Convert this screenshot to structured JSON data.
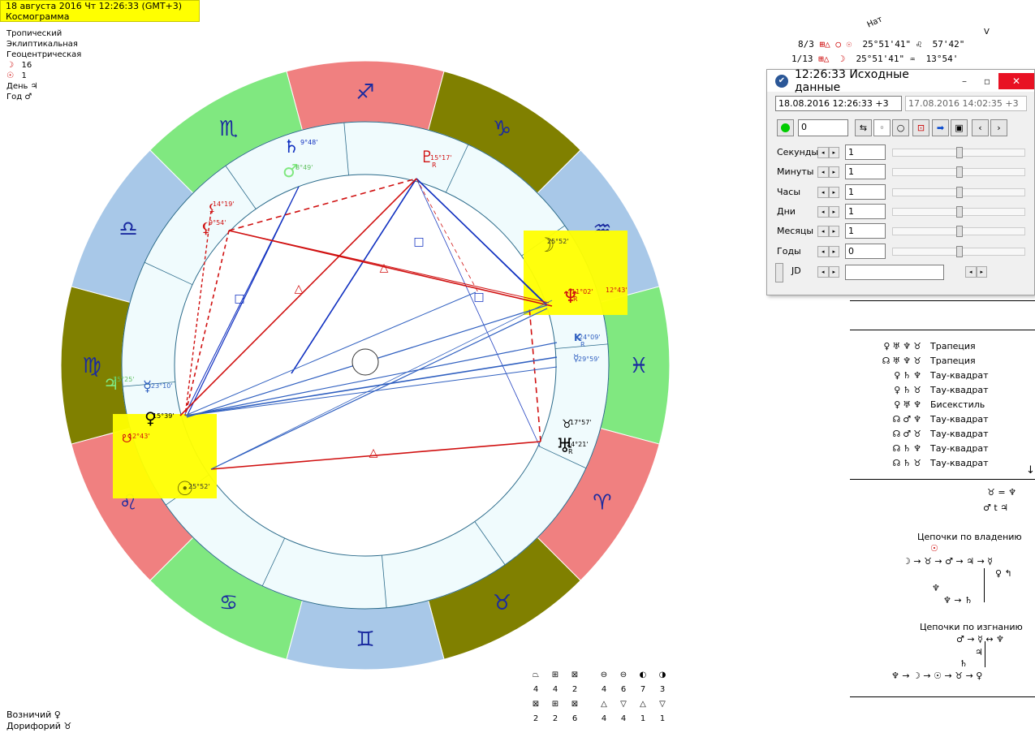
{
  "header": {
    "datetime": "18 августа 2016  Чт  12:26:33 (GMT+3)",
    "mode": "Космограмма"
  },
  "settings": {
    "zodiac": "Тропический",
    "coords": "Эклиптикальная",
    "center": "Геоцентрическая",
    "moon_glyph": "☽",
    "moon_val": "16",
    "sun_glyph": "☉",
    "sun_val": "1",
    "day_label": "День",
    "day_glyph": "♃",
    "year_label": "Год",
    "year_glyph": "♂"
  },
  "natal": {
    "header_nat": "Нат",
    "header_v": "V",
    "row1": {
      "a": "8/3",
      "b": "⊞△ ○ ☉",
      "c": "25°51'41\" ♌",
      "d": "57'42\""
    },
    "row2": {
      "a": "1/13",
      "b": "⊞△  ☽",
      "c": "25°51'41\" ♒",
      "d": "13°54'"
    }
  },
  "dialog": {
    "title": "12:26:33 Исходные данные",
    "date_input": "18.08.2016  12:26:33  +3",
    "date_ref": "17.08.2016   14:02:35  +3",
    "counter": "0",
    "rows": [
      {
        "label": "Секунды",
        "value": "1"
      },
      {
        "label": "Минуты",
        "value": "1"
      },
      {
        "label": "Часы",
        "value": "1"
      },
      {
        "label": "Дни",
        "value": "1"
      },
      {
        "label": "Месяцы",
        "value": "1"
      },
      {
        "label": "Годы",
        "value": "0"
      }
    ],
    "jd_label": "JD",
    "jd_value": ""
  },
  "aspects": [
    {
      "glyphs": "♀♅♆♉",
      "name": "Трапеция"
    },
    {
      "glyphs": "☊♅♆♉",
      "name": "Трапеция"
    },
    {
      "glyphs": "♀♄♆",
      "name": "Тау-квадрат"
    },
    {
      "glyphs": "♀♄♉",
      "name": "Тау-квадрат"
    },
    {
      "glyphs": "♀♅♆",
      "name": "Бисекстиль"
    },
    {
      "glyphs": "☊♂♆",
      "name": "Тау-квадрат"
    },
    {
      "glyphs": "☊♂♉",
      "name": "Тау-квадрат"
    },
    {
      "glyphs": "☊♄♆",
      "name": "Тау-квадрат"
    },
    {
      "glyphs": "☊♄♉",
      "name": "Тау-квадрат"
    }
  ],
  "misc": {
    "eq1": "♉ = ♆",
    "eq2": "♂ t ♃",
    "scroll": "↓"
  },
  "chains": {
    "own_title": "Цепочки по владению",
    "own_root": "☉",
    "own_line": "☽ → ♉ → ♂ → ♃ → ☿",
    "own_sub1": "♀ ↰",
    "own_sub2": "♆",
    "own_sub3": "♆ → ♄",
    "exile_title": "Цепочки по изгнанию",
    "exile_line1": "♂ → ☿ ↔ ♆",
    "exile_sub1": "♃",
    "exile_sub2": "♄",
    "exile_line2": "♆ → ☽ → ☉ → ♉ → ♀"
  },
  "stats": {
    "row1": [
      "4",
      "4",
      "2",
      "4",
      "6",
      "7",
      "3"
    ],
    "row2": [
      "2",
      "2",
      "6",
      "4",
      "4",
      "1",
      "1"
    ],
    "icons1": [
      "⏢",
      "⊞",
      "⊠",
      "⊖",
      "⊖",
      "◐",
      "◑"
    ],
    "icons2": [
      "⊠",
      "⊞",
      "⊠",
      "△",
      "▽",
      "△",
      "▽"
    ]
  },
  "footer": {
    "voz": "Возничий",
    "voz_glyph": "♀",
    "dor": "Дорифорий",
    "dor_glyph": "♉"
  },
  "signs": [
    "♐",
    "♑",
    "♒",
    "♓",
    "♈",
    "♉",
    "♊",
    "♋",
    "♌",
    "♍",
    "♎",
    "♏"
  ],
  "planets": {
    "saturn": {
      "glyph": "♄",
      "deg": "9°48'"
    },
    "mars": {
      "glyph": "♂",
      "deg": "8°49'"
    },
    "pluto": {
      "glyph": "♇",
      "deg": "15°17'",
      "r": "R"
    },
    "moon": {
      "glyph": "☽",
      "deg": "25°52'"
    },
    "neptune": {
      "glyph": "♆",
      "deg": "11°02'",
      "r": "R",
      "node_deg": "12°43'"
    },
    "chiron": {
      "glyph": "K",
      "deg": "24°09'",
      "r": "R"
    },
    "mercury2": {
      "glyph": "☿",
      "deg": "29°59'"
    },
    "uranus": {
      "glyph": "♅",
      "deg": "24°21'",
      "r": "R"
    },
    "node": {
      "glyph": "♉",
      "deg": "17°57'"
    },
    "sun": {
      "glyph": "☉",
      "deg": "25°52'"
    },
    "venus": {
      "glyph": "♀",
      "deg": "15°39'"
    },
    "southnode": {
      "glyph": "☋",
      "deg": "12°43'"
    },
    "mercury": {
      "glyph": "☿",
      "deg": "23°10'"
    },
    "jupiter": {
      "glyph": "♃",
      "deg": "25°25'"
    },
    "lilith": {
      "glyph": "⚸",
      "deg": "9°54'"
    },
    "lilith2": {
      "glyph": "⚸",
      "deg": "14°19'"
    }
  }
}
